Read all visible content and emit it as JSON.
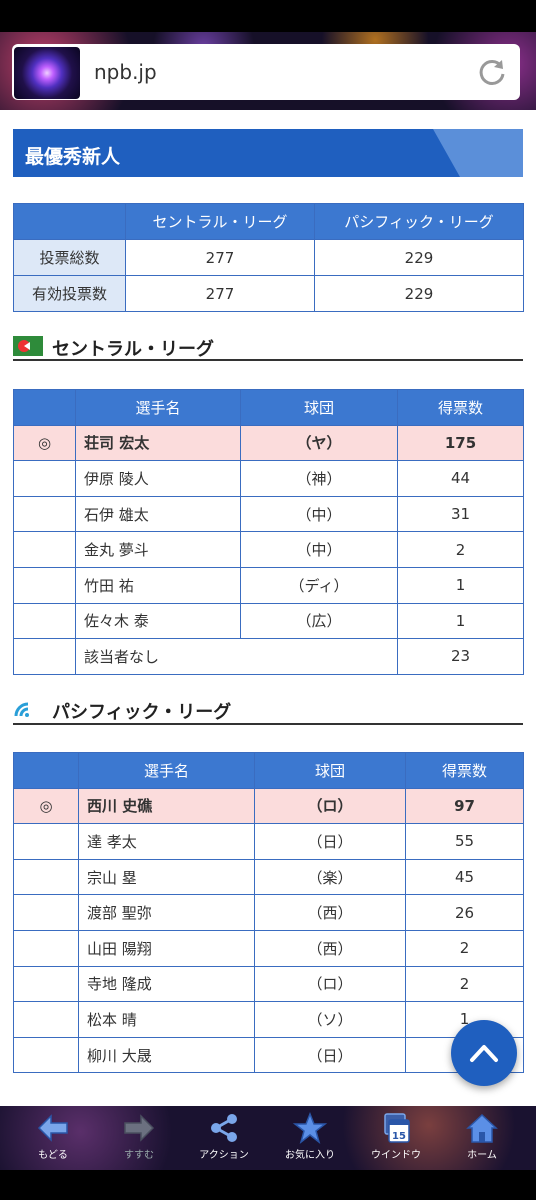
{
  "browser": {
    "url": "npb.jp"
  },
  "section": {
    "title": "最優秀新人"
  },
  "vote_summary": {
    "headers": [
      "",
      "セントラル・リーグ",
      "パシフィック・リーグ"
    ],
    "rows": [
      {
        "label": "投票総数",
        "central": "277",
        "pacific": "229"
      },
      {
        "label": "有効投票数",
        "central": "277",
        "pacific": "229"
      }
    ]
  },
  "central": {
    "title": "セントラル・リーグ",
    "headers": [
      "",
      "選手名",
      "球団",
      "得票数"
    ],
    "rows": [
      {
        "mark": "◎",
        "name": "荘司 宏太",
        "team": "（ヤ）",
        "votes": "175"
      },
      {
        "mark": "",
        "name": "伊原 陵人",
        "team": "（神）",
        "votes": "44"
      },
      {
        "mark": "",
        "name": "石伊 雄太",
        "team": "（中）",
        "votes": "31"
      },
      {
        "mark": "",
        "name": "金丸 夢斗",
        "team": "（中）",
        "votes": "2"
      },
      {
        "mark": "",
        "name": "竹田 祐",
        "team": "（ディ）",
        "votes": "1"
      },
      {
        "mark": "",
        "name": "佐々木 泰",
        "team": "（広）",
        "votes": "1"
      },
      {
        "mark": "",
        "name": "該当者なし",
        "team": "",
        "votes": "23"
      }
    ]
  },
  "pacific": {
    "title": "パシフィック・リーグ",
    "headers": [
      "",
      "選手名",
      "球団",
      "得票数"
    ],
    "rows": [
      {
        "mark": "◎",
        "name": "西川 史礁",
        "team": "（ロ）",
        "votes": "97"
      },
      {
        "mark": "",
        "name": "達 孝太",
        "team": "（日）",
        "votes": "55"
      },
      {
        "mark": "",
        "name": "宗山 塁",
        "team": "（楽）",
        "votes": "45"
      },
      {
        "mark": "",
        "name": "渡部 聖弥",
        "team": "（西）",
        "votes": "26"
      },
      {
        "mark": "",
        "name": "山田 陽翔",
        "team": "（西）",
        "votes": "2"
      },
      {
        "mark": "",
        "name": "寺地 隆成",
        "team": "（ロ）",
        "votes": "2"
      },
      {
        "mark": "",
        "name": "松本 晴",
        "team": "（ソ）",
        "votes": "1"
      },
      {
        "mark": "",
        "name": "柳川 大晟",
        "team": "（日）",
        "votes": ""
      }
    ]
  },
  "toolbar": {
    "items": [
      {
        "label": "もどる",
        "icon": "arrow-left-icon"
      },
      {
        "label": "すすむ",
        "icon": "arrow-right-icon"
      },
      {
        "label": "アクション",
        "icon": "share-icon"
      },
      {
        "label": "お気に入り",
        "icon": "star-icon"
      },
      {
        "label": "ウインドウ",
        "icon": "windows-icon",
        "badge": "15"
      },
      {
        "label": "ホーム",
        "icon": "home-icon"
      }
    ]
  },
  "colors": {
    "primary": "#1f5fbf",
    "header": "#3c78d0",
    "highlight": "#fbdcdc"
  }
}
